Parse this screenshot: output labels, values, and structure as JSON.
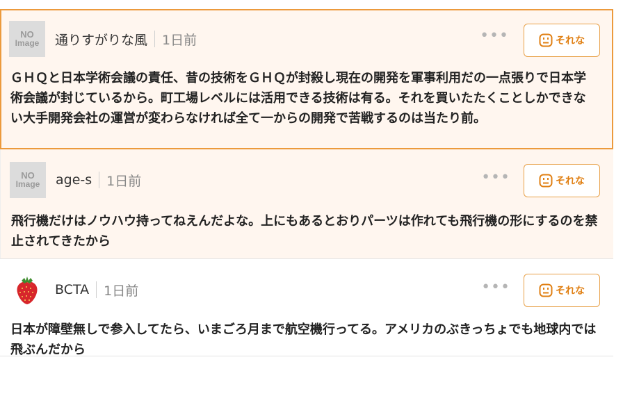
{
  "comments": [
    {
      "user": "通りすがりな風",
      "time": "1日前",
      "avatar_text": [
        "NO",
        "Image"
      ],
      "more_icon": "ellipsis-icon",
      "reaction_icon": "neutral-face-icon",
      "reaction_label": "それな",
      "text": "ＧＨＱと日本学術会議の責任、昔の技術をＧＨＱが封殺し現在の開発を軍事利用だの一点張りで日本学術会議が封じているから。町工場レベルには活用できる技術は有る。それを買いたたくことしかできない大手開発会社の運営が変わらなければ全て一からの開発で苦戦するのは当たり前。"
    },
    {
      "user": "age-s",
      "time": "1日前",
      "avatar_text": [
        "NO",
        "Image"
      ],
      "more_icon": "ellipsis-icon",
      "reaction_icon": "neutral-face-icon",
      "reaction_label": "それな",
      "text": "飛行機だけはノウハウ持ってねえんだよな。上にもあるとおりパーツは作れても飛行機の形にするのを禁止されてきたから"
    },
    {
      "user": "BCTA",
      "time": "1日前",
      "avatar_icon": "strawberry-icon",
      "more_icon": "ellipsis-icon",
      "reaction_icon": "neutral-face-icon",
      "reaction_label": "それな",
      "text": "日本が障壁無しで参入してたら、いまごろ月まで航空機行ってる。アメリカのぶきっちょでも地球内では飛ぶんだから"
    }
  ],
  "colors": {
    "accent": "#e07f12",
    "highlight_border": "#ec9a3c",
    "highlight_bg": "#fff6ef"
  }
}
